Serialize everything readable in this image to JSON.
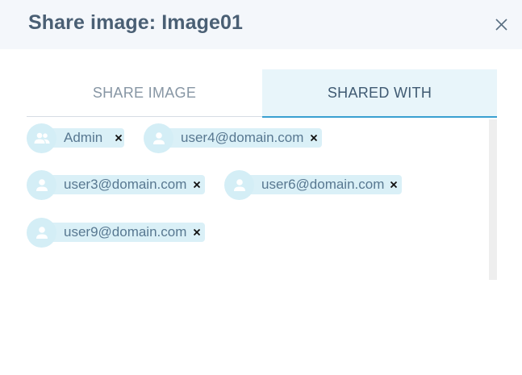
{
  "dialog": {
    "title": "Share image: Image01",
    "close_icon": "close-icon"
  },
  "tabs": [
    {
      "label": "SHARE IMAGE",
      "active": false
    },
    {
      "label": "SHARED WITH",
      "active": true
    }
  ],
  "shared_with": [
    {
      "label": "Admin",
      "icon": "group-icon"
    },
    {
      "label": "user4@domain.com",
      "icon": "person-icon"
    },
    {
      "label": "user3@domain.com",
      "icon": "person-icon"
    },
    {
      "label": "user6@domain.com",
      "icon": "person-icon"
    },
    {
      "label": "user9@domain.com",
      "icon": "person-icon"
    }
  ],
  "colors": {
    "accent": "#3aa0d1",
    "chip_bg": "#daf0f7",
    "title": "#4a5f74"
  }
}
